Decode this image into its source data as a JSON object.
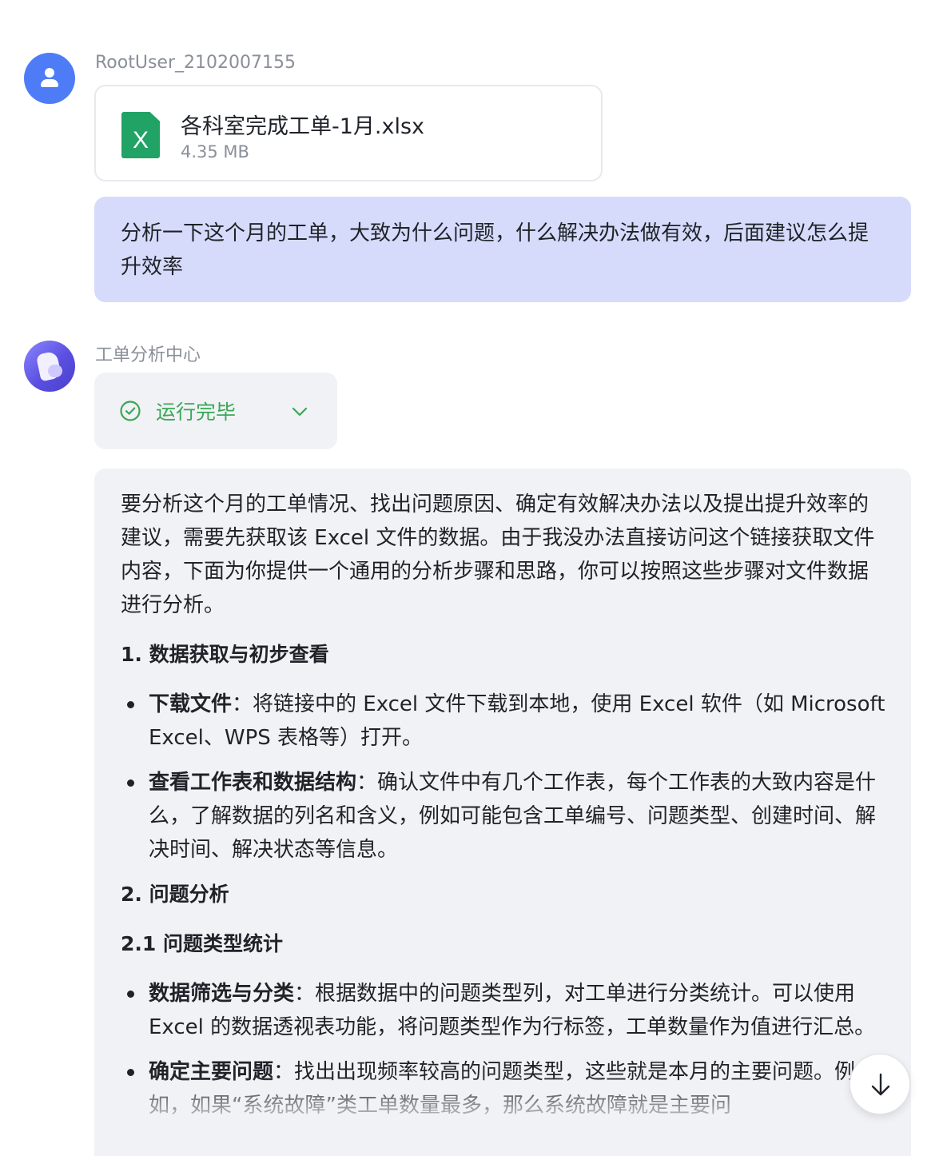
{
  "user_message": {
    "sender": "RootUser_2102007155",
    "attachment": {
      "icon": "excel-file-icon",
      "icon_letter": "X",
      "name": "各科室完成工单-1月.xlsx",
      "size": "4.35 MB"
    },
    "text": "分析一下这个月的工单，大致为什么问题，什么解决办法做有效，后面建议怎么提升效率"
  },
  "bot_message": {
    "sender": "工单分析中心",
    "status": {
      "label": "运行完毕",
      "icon": "check-circle-icon",
      "toggle_icon": "chevron-down-icon",
      "color": "#3aa657"
    },
    "answer": {
      "intro": "要分析这个月的工单情况、找出问题原因、确定有效解决办法以及提出提升效率的建议，需要先获取该 Excel 文件的数据。由于我没办法直接访问这个链接获取文件内容，下面为你提供一个通用的分析步骤和思路，你可以按照这些步骤对文件数据进行分析。",
      "section1_title": "1. 数据获取与初步查看",
      "section1_items": [
        {
          "title": "下载文件",
          "text": "：将链接中的 Excel 文件下载到本地，使用 Excel 软件（如 Microsoft Excel、WPS 表格等）打开。"
        },
        {
          "title": "查看工作表和数据结构",
          "text": "：确认文件中有几个工作表，每个工作表的大致内容是什么，了解数据的列名和含义，例如可能包含工单编号、问题类型、创建时间、解决时间、解决状态等信息。"
        }
      ],
      "section2_title": "2. 问题分析",
      "section21_title": "2.1 问题类型统计",
      "section21_items": [
        {
          "title": "数据筛选与分类",
          "text": "：根据数据中的问题类型列，对工单进行分类统计。可以使用 Excel 的数据透视表功能，将问题类型作为行标签，工单数量作为值进行汇总。"
        },
        {
          "title": "确定主要问题",
          "text": "：找出出现频率较高的问题类型，这些就是本月的主要问题。例如，如果“系统故障”类工单数量最多，那么系统故障就是主要问"
        }
      ]
    }
  },
  "controls": {
    "scroll_down_icon": "arrow-down-icon"
  },
  "colors": {
    "user_bubble": "#d7dbfb",
    "user_avatar": "#4e7cf6",
    "bot_card": "#f1f2f5",
    "status_green": "#3aa657",
    "excel_green": "#21a366"
  }
}
